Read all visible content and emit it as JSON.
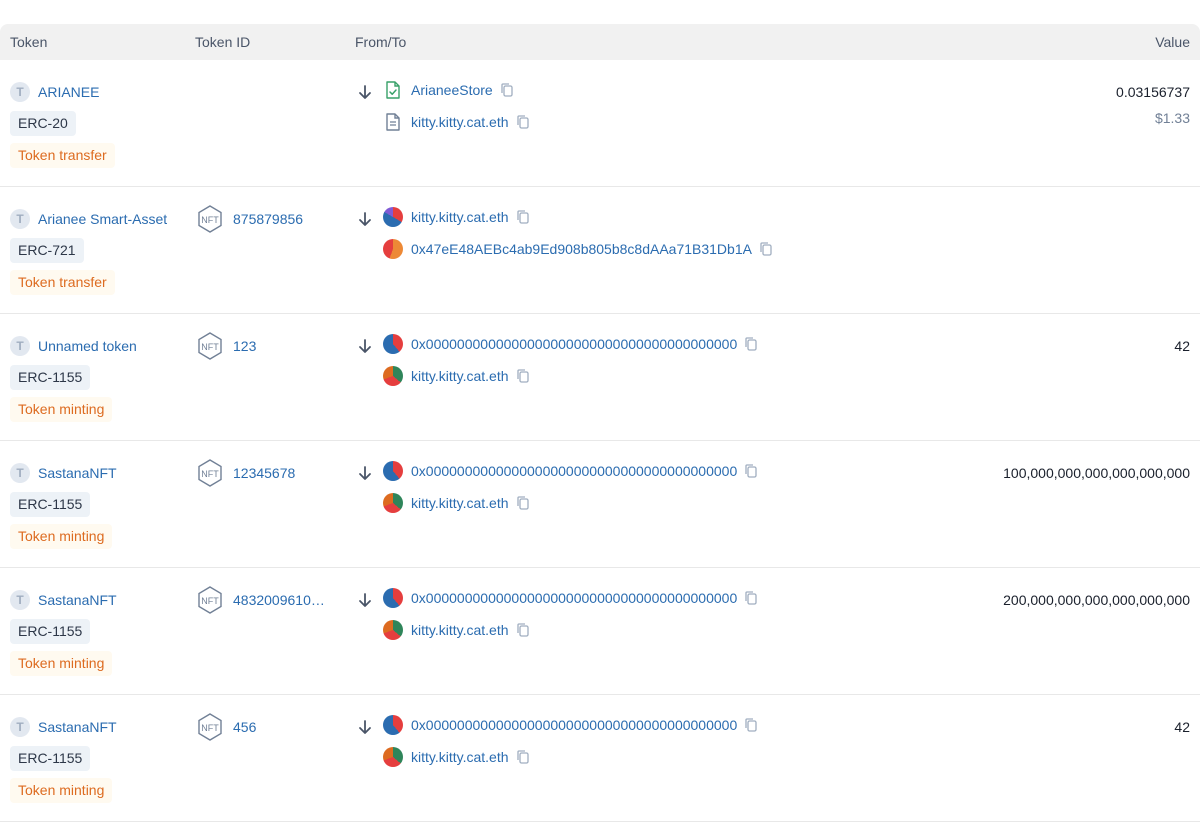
{
  "header": {
    "token": "Token",
    "token_id": "Token ID",
    "from_to": "From/To",
    "value": "Value"
  },
  "rows": [
    {
      "token_letter": "T",
      "token_name": "ARIANEE",
      "token_type": "ERC-20",
      "method": "Token transfer",
      "token_id": "",
      "from": "ArianeeStore",
      "to": "kitty.kitty.cat.eth",
      "value": "0.03156737",
      "usd": "$1.33"
    },
    {
      "token_letter": "T",
      "token_name": "Arianee Smart-Asset",
      "token_type": "ERC-721",
      "method": "Token transfer",
      "token_id": "875879856",
      "from": "kitty.kitty.cat.eth",
      "to": "0x47eE48AEBc4ab9Ed908b805b8c8dAAa71B31Db1A",
      "value": "",
      "usd": ""
    },
    {
      "token_letter": "T",
      "token_name": "Unnamed token",
      "token_type": "ERC-1155",
      "method": "Token minting",
      "token_id": "123",
      "from": "0x0000000000000000000000000000000000000000",
      "to": "kitty.kitty.cat.eth",
      "value": "42",
      "usd": ""
    },
    {
      "token_letter": "T",
      "token_name": "SastanaNFT",
      "token_type": "ERC-1155",
      "method": "Token minting",
      "token_id": "12345678",
      "from": "0x0000000000000000000000000000000000000000",
      "to": "kitty.kitty.cat.eth",
      "value": "100,000,000,000,000,000,000",
      "usd": ""
    },
    {
      "token_letter": "T",
      "token_name": "SastanaNFT",
      "token_type": "ERC-1155",
      "method": "Token minting",
      "token_id": "4832009610…",
      "from": "0x0000000000000000000000000000000000000000",
      "to": "kitty.kitty.cat.eth",
      "value": "200,000,000,000,000,000,000",
      "usd": ""
    },
    {
      "token_letter": "T",
      "token_name": "SastanaNFT",
      "token_type": "ERC-1155",
      "method": "Token minting",
      "token_id": "456",
      "from": "0x0000000000000000000000000000000000000000",
      "to": "kitty.kitty.cat.eth",
      "value": "42",
      "usd": ""
    }
  ],
  "icons": {
    "arrow": "arrow-down-icon",
    "copy": "copy-icon",
    "nft": "nft-hexagon-icon",
    "contract_verified": "verified-contract-icon",
    "contract": "contract-file-icon"
  },
  "colors": {
    "link": "#2b6cb0",
    "method": "#dd6b20",
    "method_bg": "#fffaf0",
    "header_bg": "#f1f1f1"
  }
}
